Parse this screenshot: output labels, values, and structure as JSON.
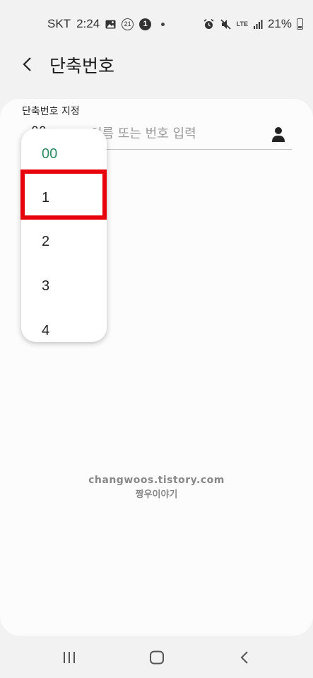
{
  "status_bar": {
    "carrier": "SKT",
    "time": "2:24",
    "notification_count": "21",
    "badge": "1",
    "network": "LTE",
    "battery": "21%"
  },
  "header": {
    "title": "단축번호"
  },
  "form": {
    "label": "단축번호 지정",
    "peek_value": "00",
    "placeholder": "이름 또는 번호 입력"
  },
  "picker": {
    "options": [
      "00",
      "1",
      "2",
      "3",
      "4"
    ],
    "selected": "00"
  },
  "watermark": {
    "line1": "changwoos.tistory.com",
    "line2": "짱우이야기"
  },
  "colors": {
    "background": "#f2f2f2",
    "card": "#fcfcfc",
    "selected_option": "#2e8b63",
    "highlight": "#e8000b"
  }
}
